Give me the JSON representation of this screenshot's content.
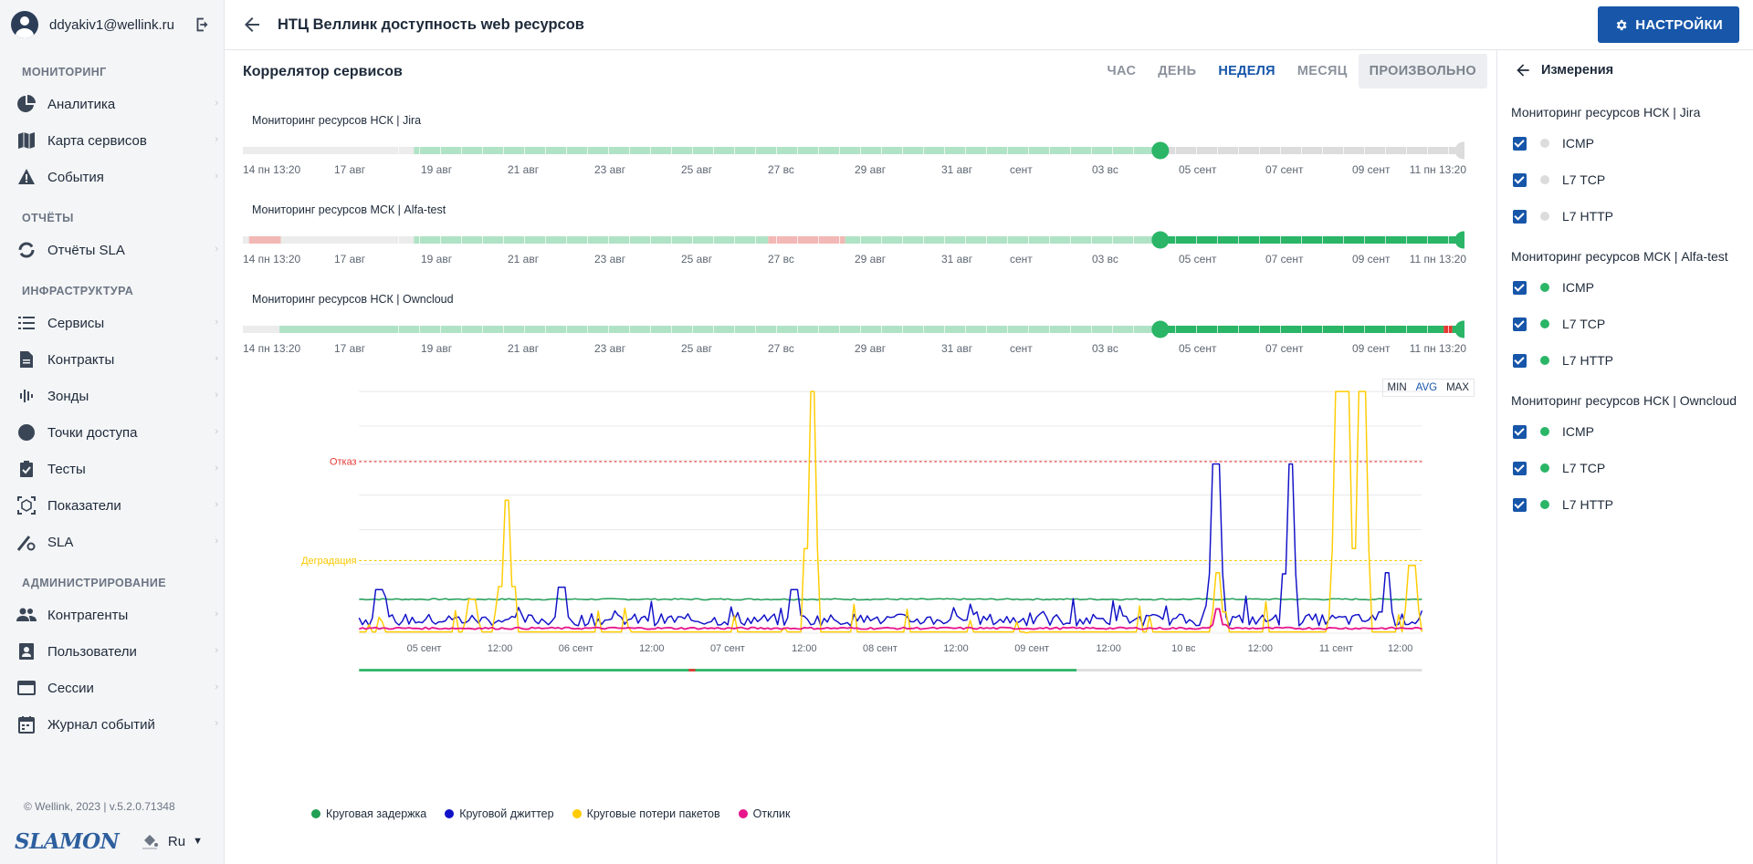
{
  "user": {
    "email": "ddyakiv1@wellink.ru"
  },
  "sidebar": {
    "sections": [
      {
        "title": "МОНИТОРИНГ",
        "items": [
          {
            "label": "Аналитика",
            "icon": "pie-chart-icon"
          },
          {
            "label": "Карта сервисов",
            "icon": "map-icon"
          },
          {
            "label": "События",
            "icon": "warning-icon"
          }
        ]
      },
      {
        "title": "ОТЧЁТЫ",
        "items": [
          {
            "label": "Отчёты SLA",
            "icon": "refresh-circle-icon"
          }
        ]
      },
      {
        "title": "ИНФРАСТРУКТУРА",
        "items": [
          {
            "label": "Сервисы",
            "icon": "list-icon"
          },
          {
            "label": "Контракты",
            "icon": "document-icon"
          },
          {
            "label": "Зонды",
            "icon": "probe-icon"
          },
          {
            "label": "Точки доступа",
            "icon": "circle-icon"
          },
          {
            "label": "Тесты",
            "icon": "clipboard-check-icon"
          },
          {
            "label": "Показатели",
            "icon": "metrics-icon"
          },
          {
            "label": "SLA",
            "icon": "sla-icon"
          }
        ]
      },
      {
        "title": "АДМИНИСТРИРОВАНИЕ",
        "items": [
          {
            "label": "Контрагенты",
            "icon": "people-icon"
          },
          {
            "label": "Пользователи",
            "icon": "contact-icon"
          },
          {
            "label": "Сессии",
            "icon": "window-icon"
          },
          {
            "label": "Журнал событий",
            "icon": "calendar-icon"
          }
        ]
      }
    ],
    "footer": {
      "copyright": "© Wellink, 2023 | v.5.2.0.71348",
      "logo": "SLAMON",
      "lang": "Ru"
    }
  },
  "header": {
    "title": "НТЦ Веллинк доступность web ресурсов",
    "settings_label": "НАСТРОЙКИ"
  },
  "main": {
    "title": "Коррелятор сервисов",
    "periods": [
      {
        "label": "ЧАС",
        "active": false
      },
      {
        "label": "ДЕНЬ",
        "active": false
      },
      {
        "label": "НЕДЕЛЯ",
        "active": true
      },
      {
        "label": "МЕСЯЦ",
        "active": false
      },
      {
        "label": "ПРОИЗВОЛЬНО",
        "active": false
      }
    ],
    "timeline_labels": [
      "14 пн 13:20",
      "17 авг",
      "19 авг",
      "21 авг",
      "23 авг",
      "25 авг",
      "27 вс",
      "29 авг",
      "31 авг",
      "сент",
      "03 вс",
      "05 сент",
      "07 сент",
      "09 сент",
      "11 пн 13:20"
    ],
    "timelines": [
      {
        "title": "Мониторинг ресурсов НСК | Jira",
        "handle_start": 0.751,
        "handle_end": 1.0,
        "segments": [
          {
            "from": 0.0,
            "to": 0.14,
            "state": "nodata"
          },
          {
            "from": 0.14,
            "to": 0.751,
            "state": "ok-light"
          },
          {
            "from": 0.751,
            "to": 1.0,
            "state": "nodata-dark"
          }
        ]
      },
      {
        "title": "Мониторинг ресурсов МСК | Alfa-test",
        "handle_start": 0.751,
        "handle_end": 1.0,
        "segments": [
          {
            "from": 0.0,
            "to": 0.005,
            "state": "nodata"
          },
          {
            "from": 0.005,
            "to": 0.031,
            "state": "fail-light"
          },
          {
            "from": 0.031,
            "to": 0.14,
            "state": "nodata"
          },
          {
            "from": 0.14,
            "to": 0.43,
            "state": "ok-light"
          },
          {
            "from": 0.43,
            "to": 0.493,
            "state": "fail-light"
          },
          {
            "from": 0.493,
            "to": 0.751,
            "state": "ok-light"
          },
          {
            "from": 0.751,
            "to": 1.0,
            "state": "ok"
          }
        ]
      },
      {
        "title": "Мониторинг ресурсов НСК | Owncloud",
        "handle_start": 0.751,
        "handle_end": 1.0,
        "segments": [
          {
            "from": 0.0,
            "to": 0.03,
            "state": "nodata"
          },
          {
            "from": 0.03,
            "to": 0.751,
            "state": "ok-light"
          },
          {
            "from": 0.751,
            "to": 0.983,
            "state": "ok"
          },
          {
            "from": 0.983,
            "to": 0.99,
            "state": "fail"
          },
          {
            "from": 0.99,
            "to": 1.0,
            "state": "ok"
          }
        ]
      }
    ],
    "chart_data": {
      "type": "line",
      "x_labels": [
        "05 сент",
        "12:00",
        "06 сент",
        "12:00",
        "07 сент",
        "12:00",
        "08 сент",
        "12:00",
        "09 сент",
        "12:00",
        "10 вс",
        "12:00",
        "11 сент",
        "12:00"
      ],
      "thresholds": [
        {
          "label": "Отказ",
          "level": 0.71,
          "color": "#e53935"
        },
        {
          "label": "Деградация",
          "level": 0.3,
          "color": "#f9c800"
        }
      ],
      "series": [
        {
          "name": "Круговая задержка",
          "color": "#1fa055",
          "baseline": 0.14
        },
        {
          "name": "Круговой джиттер",
          "color": "#1111c8",
          "baseline": 0.03,
          "spikes": [
            [
              0.018,
              0.18
            ],
            [
              0.19,
              0.19
            ],
            [
              0.41,
              0.18
            ],
            [
              0.806,
              0.7
            ],
            [
              0.876,
              0.7
            ],
            [
              0.967,
              0.25
            ]
          ]
        },
        {
          "name": "Круговые потери пакетов",
          "color": "#ffcc00",
          "baseline": 0.0,
          "spikes": [
            [
              0.139,
              0.55
            ],
            [
              0.107,
              0.14
            ],
            [
              0.426,
              1.0
            ],
            [
              0.808,
              0.25
            ],
            [
              0.922,
              1.0
            ],
            [
              0.93,
              1.0
            ],
            [
              0.943,
              1.0
            ],
            [
              0.99,
              0.28
            ]
          ]
        },
        {
          "name": "Отклик",
          "color": "#e8168a",
          "baseline": 0.02,
          "spikes": [
            [
              0.808,
              0.1
            ]
          ]
        }
      ],
      "minmax": [
        {
          "label": "MIN",
          "active": false
        },
        {
          "label": "AVG",
          "active": true
        },
        {
          "label": "MAX",
          "active": false
        }
      ]
    }
  },
  "right_panel": {
    "title": "Измерения",
    "groups": [
      {
        "title": "Мониторинг ресурсов НСК | Jira",
        "items": [
          {
            "label": "ICMP",
            "status": "#dcdcdc"
          },
          {
            "label": "L7 TCP",
            "status": "#dcdcdc"
          },
          {
            "label": "L7 HTTP",
            "status": "#dcdcdc"
          }
        ]
      },
      {
        "title": "Мониторинг ресурсов МСК | Alfa-test",
        "items": [
          {
            "label": "ICMP",
            "status": "#2ab567"
          },
          {
            "label": "L7 TCP",
            "status": "#2ab567"
          },
          {
            "label": "L7 HTTP",
            "status": "#2ab567"
          }
        ]
      },
      {
        "title": "Мониторинг ресурсов НСК | Owncloud",
        "items": [
          {
            "label": "ICMP",
            "status": "#2ab567"
          },
          {
            "label": "L7 TCP",
            "status": "#2ab567"
          },
          {
            "label": "L7 HTTP",
            "status": "#2ab567"
          }
        ]
      }
    ]
  }
}
